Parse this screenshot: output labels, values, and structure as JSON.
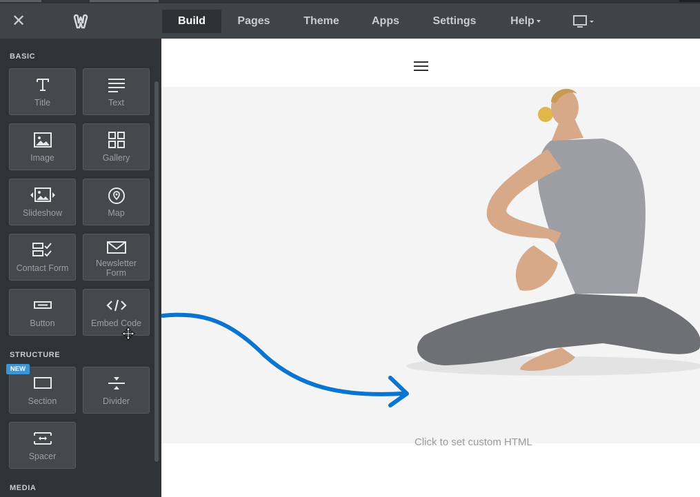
{
  "topbar": {
    "close_label": "✕",
    "nav": [
      {
        "label": "Build",
        "active": true
      },
      {
        "label": "Pages"
      },
      {
        "label": "Theme"
      },
      {
        "label": "Apps"
      },
      {
        "label": "Settings"
      },
      {
        "label": "Help"
      }
    ],
    "device_icon": "desktop-monitor-icon"
  },
  "sidebar": {
    "sections": [
      {
        "title": "BASIC"
      },
      {
        "title": "STRUCTURE"
      },
      {
        "title": "MEDIA"
      }
    ],
    "basic": [
      {
        "label": "Title",
        "icon": "title-T-icon"
      },
      {
        "label": "Text",
        "icon": "text-lines-icon"
      },
      {
        "label": "Image",
        "icon": "image-icon"
      },
      {
        "label": "Gallery",
        "icon": "gallery-grid-icon"
      },
      {
        "label": "Slideshow",
        "icon": "slideshow-icon"
      },
      {
        "label": "Map",
        "icon": "map-pin-icon"
      },
      {
        "label": "Contact Form",
        "icon": "contact-form-icon"
      },
      {
        "label": "Newsletter Form",
        "icon": "envelope-icon"
      },
      {
        "label": "Button",
        "icon": "button-icon"
      },
      {
        "label": "Embed Code",
        "icon": "code-icon"
      }
    ],
    "structure": [
      {
        "label": "Section",
        "icon": "section-icon",
        "badge": "NEW"
      },
      {
        "label": "Divider",
        "icon": "divider-icon"
      },
      {
        "label": "Spacer",
        "icon": "spacer-icon"
      }
    ]
  },
  "canvas": {
    "custom_html_text": "Click to set custom HTML",
    "menu_icon": "hamburger-menu-icon"
  },
  "colors": {
    "accent_blue": "#0a74d1",
    "badge_blue": "#3d95d6",
    "topbar_bg": "#3f4446",
    "sidebar_bg": "#2f3335"
  }
}
